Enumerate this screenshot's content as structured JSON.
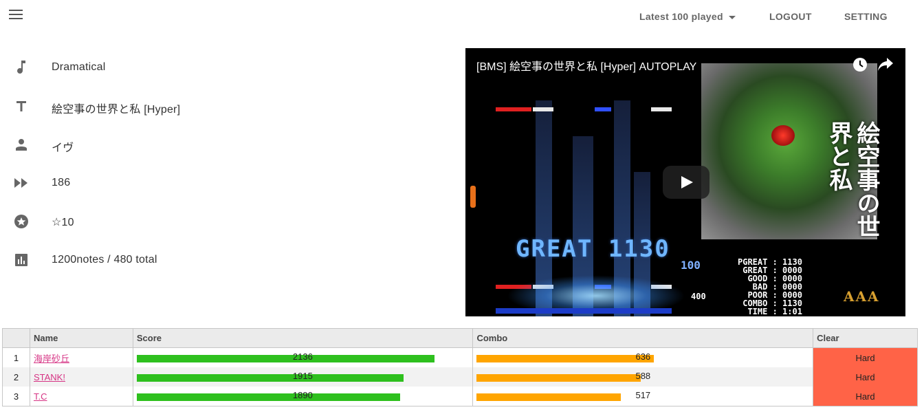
{
  "topbar": {
    "latest_label": "Latest 100 played",
    "logout_label": "LOGOUT",
    "setting_label": "SETTING"
  },
  "info": {
    "genre": "Dramatical",
    "title": "絵空事の世界と私 [Hyper]",
    "artist": "イヴ",
    "bpm": "186",
    "level": "☆10",
    "notes": "1200notes / 480 total"
  },
  "video": {
    "title": "[BMS] 絵空事の世界と私 [Hyper] AUTOPLAY",
    "art_title": "絵空事の世界と私",
    "judge_text": "GREAT 1130",
    "gauge_value": "100",
    "bpm_display": "400",
    "stats_text": "PGREAT : 1130\n GREAT : 0000\n  GOOD : 0000\n   BAD : 0000\n  POOR : 0000\n COMBO : 1130\n  TIME : 1:01",
    "rank": "AAA"
  },
  "table": {
    "headers": [
      "",
      "Name",
      "Score",
      "Combo",
      "Clear"
    ],
    "score_max": 2136,
    "combo_max": 636,
    "rows": [
      {
        "rank": "1",
        "name": "海岸砂丘",
        "score": 2136,
        "combo": 636,
        "clear": "Hard"
      },
      {
        "rank": "2",
        "name": "STANK!",
        "score": 1915,
        "combo": 588,
        "clear": "Hard"
      },
      {
        "rank": "3",
        "name": "T.C",
        "score": 1890,
        "combo": 517,
        "clear": "Hard"
      }
    ]
  },
  "colors": {
    "score_bar": "#2ec01e",
    "combo_bar": "#ffa500",
    "clear_hard": "#ff6347",
    "name_link": "#d63384"
  },
  "icons": [
    "menu-icon",
    "music-note-icon",
    "title-icon",
    "person-icon",
    "fast-forward-icon",
    "star-circle-icon",
    "chart-icon",
    "clock-icon",
    "share-icon",
    "play-icon",
    "caret-down-icon"
  ]
}
